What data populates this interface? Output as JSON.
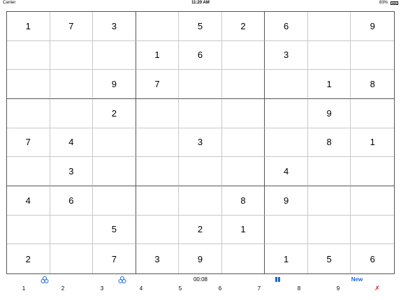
{
  "status_bar": {
    "carrier": "Carrier",
    "time": "11:20 AM",
    "battery": "83%"
  },
  "board": {
    "rows": [
      [
        "1",
        "7",
        "3",
        "",
        "5",
        "2",
        "6",
        "",
        "9"
      ],
      [
        "",
        "",
        "",
        "1",
        "6",
        "",
        "3",
        "",
        ""
      ],
      [
        "",
        "",
        "9",
        "7",
        "",
        "",
        "",
        "1",
        "8"
      ],
      [
        "",
        "",
        "2",
        "",
        "",
        "",
        "",
        "9",
        ""
      ],
      [
        "7",
        "4",
        "",
        "",
        "3",
        "",
        "",
        "8",
        "1"
      ],
      [
        "",
        "3",
        "",
        "",
        "",
        "",
        "4",
        "",
        ""
      ],
      [
        "4",
        "6",
        "",
        "",
        "",
        "8",
        "9",
        "",
        ""
      ],
      [
        "",
        "",
        "5",
        "",
        "2",
        "1",
        "",
        "",
        ""
      ],
      [
        "2",
        "",
        "7",
        "3",
        "9",
        "",
        "1",
        "5",
        "6"
      ]
    ]
  },
  "toolbar": {
    "timer": "00:08",
    "new_label": "New",
    "accent_color": "#1a66d8"
  },
  "numpad": {
    "keys": [
      "1",
      "2",
      "3",
      "4",
      "5",
      "6",
      "7",
      "8",
      "9"
    ],
    "erase_label": "✗",
    "erase_color": "#d42020"
  }
}
